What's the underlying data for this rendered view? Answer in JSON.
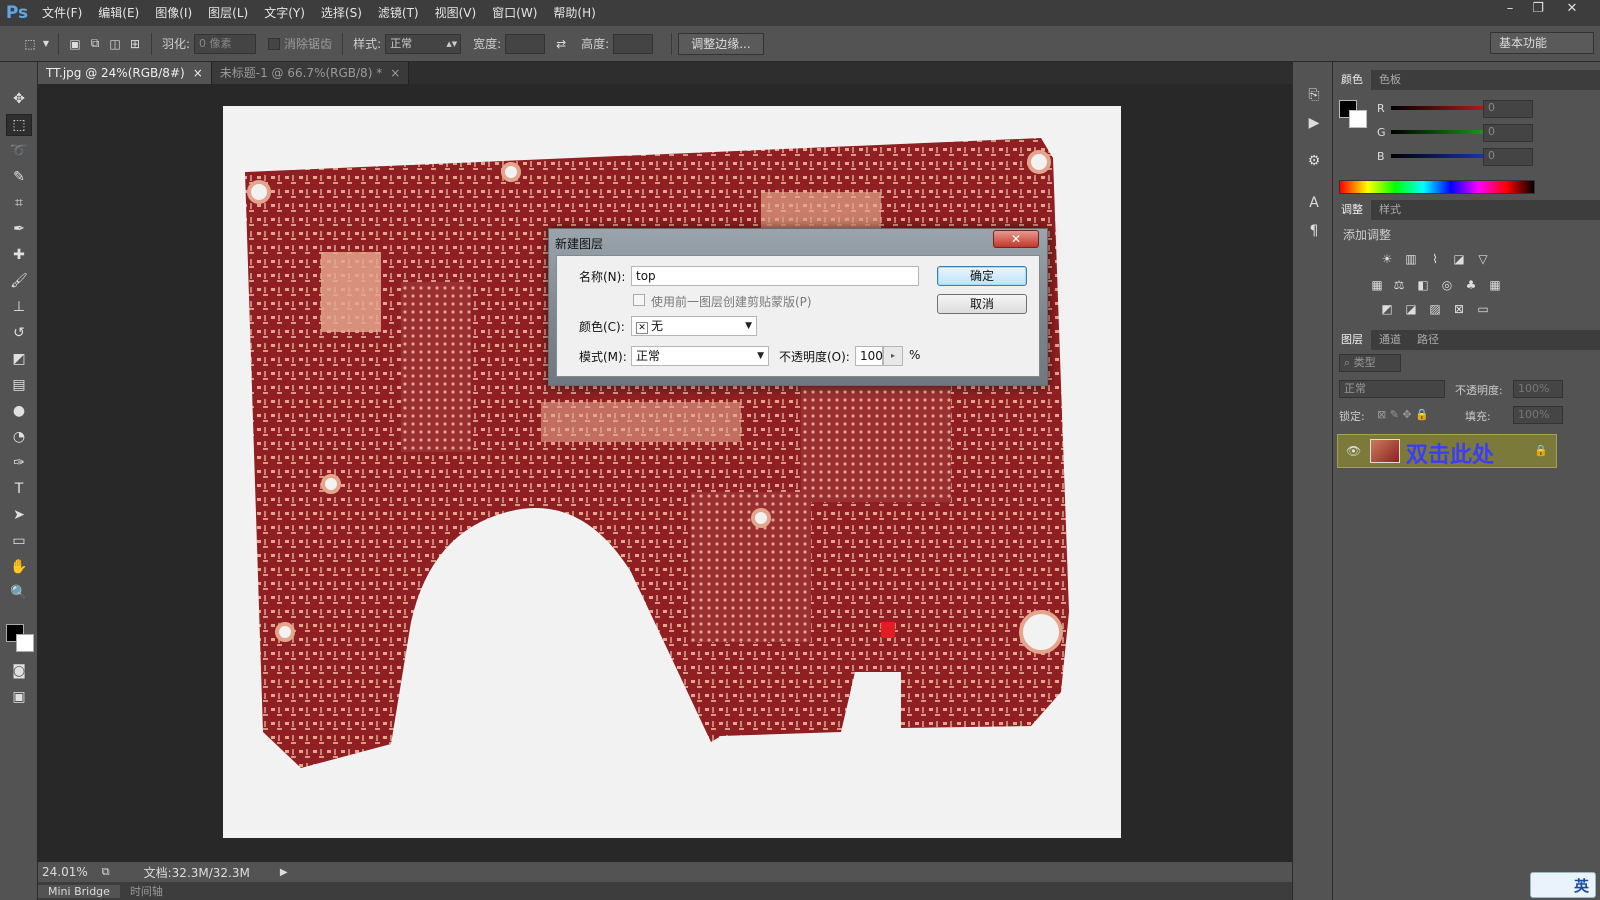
{
  "app": {
    "logo": "Ps"
  },
  "menu": [
    "文件(F)",
    "编辑(E)",
    "图像(I)",
    "图层(L)",
    "文字(Y)",
    "选择(S)",
    "滤镜(T)",
    "视图(V)",
    "窗口(W)",
    "帮助(H)"
  ],
  "window_controls": {
    "minimize": "–",
    "restore": "❐",
    "close": "✕"
  },
  "options": {
    "feather_label": "羽化:",
    "feather_value": "0 像素",
    "antialias_label": "消除锯齿",
    "style_label": "样式:",
    "style_value": "正常",
    "width_label": "宽度:",
    "height_label": "高度:",
    "refine_edge": "调整边缘...",
    "workspace": "基本功能"
  },
  "tabs": [
    {
      "label": "TT.jpg @ 24%(RGB/8#)",
      "close": "×"
    },
    {
      "label": "未标题-1 @ 66.7%(RGB/8) *",
      "close": "×"
    }
  ],
  "status": {
    "zoom": "24.01%",
    "doc": "文档:32.3M/32.3M"
  },
  "bottom_tabs": [
    "Mini Bridge",
    "时间轴"
  ],
  "color_panel": {
    "tabs": [
      "颜色",
      "色板"
    ],
    "channels": [
      {
        "label": "R",
        "value": "0",
        "color": "#e02020"
      },
      {
        "label": "G",
        "value": "0",
        "color": "#20c020"
      },
      {
        "label": "B",
        "value": "0",
        "color": "#2040e0"
      }
    ]
  },
  "adjust_panel": {
    "tabs": [
      "调整",
      "样式"
    ],
    "title": "添加调整"
  },
  "layers_panel": {
    "tabs": [
      "图层",
      "通道",
      "路径"
    ],
    "filter": "类型",
    "blend": "正常",
    "opacity_label": "不透明度:",
    "opacity_value": "100%",
    "lock_label": "锁定:",
    "fill_label": "填充:",
    "fill_value": "100%",
    "layer_name": "双击此处"
  },
  "ime": {
    "label": "英"
  },
  "dialog": {
    "title": "新建图层",
    "close": "✕",
    "name_label": "名称(N):",
    "name_value": "top",
    "clip_label": "使用前一图层创建剪贴蒙版(P)",
    "color_label": "颜色(C):",
    "color_value": "无",
    "mode_label": "模式(M):",
    "mode_value": "正常",
    "opacity_label": "不透明度(O):",
    "opacity_value": "100",
    "percent": "%",
    "ok": "确定",
    "cancel": "取消"
  },
  "colors": {
    "board": "#8f1f22",
    "copper": "#e4a58c",
    "accent": "#5fa6e8"
  }
}
